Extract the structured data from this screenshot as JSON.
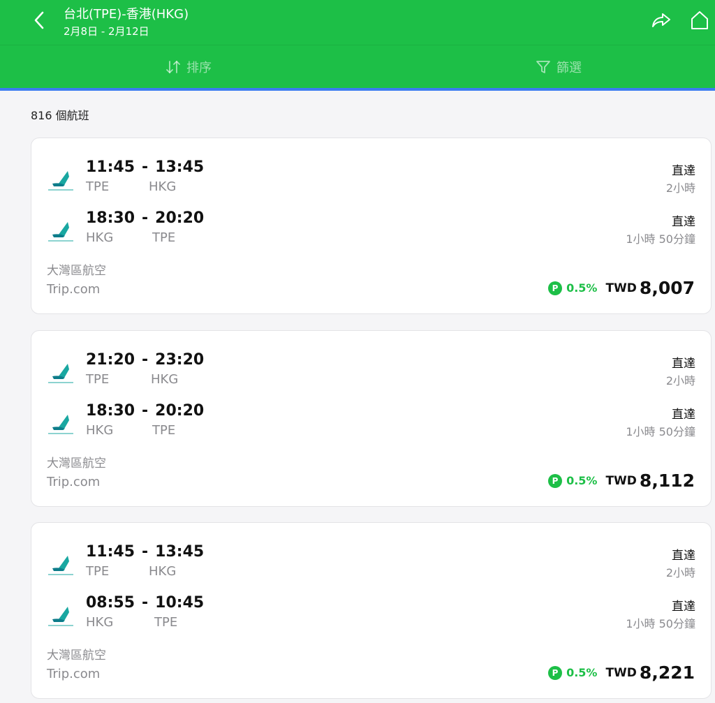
{
  "header": {
    "title": "台北(TPE)-香港(HKG)",
    "dates": "2月8日 - 2月12日",
    "icons": {
      "back": "chevron-left-icon",
      "share": "share-icon",
      "home": "home-icon"
    },
    "sort_label": "排序",
    "filter_label": "篩選",
    "colors": {
      "brand": "#1dbf47",
      "accent": "#3b7cf0"
    }
  },
  "result_count": "816 個航班",
  "flights": [
    {
      "legs": [
        {
          "dep_time": "11:45",
          "sep": "-",
          "arr_time": "13:45",
          "from": "TPE",
          "to": "HKG",
          "stops": "直達",
          "duration": "2小時"
        },
        {
          "dep_time": "18:30",
          "sep": "-",
          "arr_time": "20:20",
          "from": "HKG",
          "to": "TPE",
          "stops": "直達",
          "duration": "1小時 50分鐘"
        }
      ],
      "airline": "大灣區航空",
      "seller": "Trip.com",
      "points_icon": "P",
      "points": "0.5%",
      "currency": "TWD",
      "price": "8,007"
    },
    {
      "legs": [
        {
          "dep_time": "21:20",
          "sep": "-",
          "arr_time": "23:20",
          "from": "TPE",
          "to": "HKG",
          "stops": "直達",
          "duration": "2小時"
        },
        {
          "dep_time": "18:30",
          "sep": "-",
          "arr_time": "20:20",
          "from": "HKG",
          "to": "TPE",
          "stops": "直達",
          "duration": "1小時 50分鐘"
        }
      ],
      "airline": "大灣區航空",
      "seller": "Trip.com",
      "points_icon": "P",
      "points": "0.5%",
      "currency": "TWD",
      "price": "8,112"
    },
    {
      "legs": [
        {
          "dep_time": "11:45",
          "sep": "-",
          "arr_time": "13:45",
          "from": "TPE",
          "to": "HKG",
          "stops": "直達",
          "duration": "2小時"
        },
        {
          "dep_time": "08:55",
          "sep": "-",
          "arr_time": "10:45",
          "from": "HKG",
          "to": "TPE",
          "stops": "直達",
          "duration": "1小時 50分鐘"
        }
      ],
      "airline": "大灣區航空",
      "seller": "Trip.com",
      "points_icon": "P",
      "points": "0.5%",
      "currency": "TWD",
      "price": "8,221"
    }
  ]
}
